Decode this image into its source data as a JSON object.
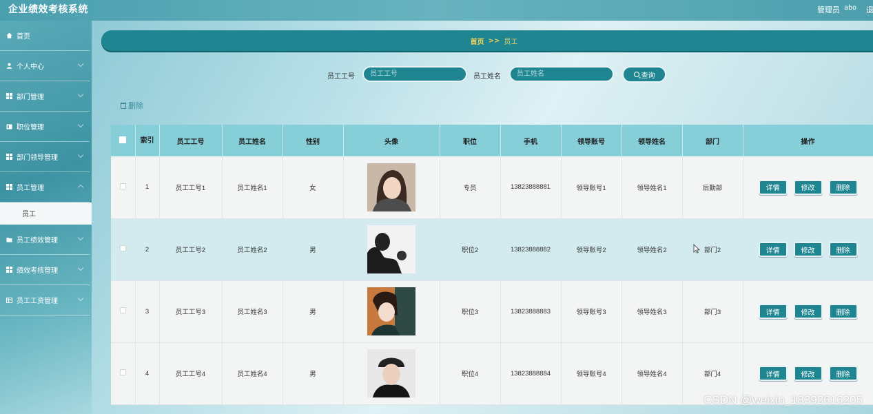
{
  "header": {
    "title": "企业绩效考核系统",
    "role": "管理员",
    "username": "abo",
    "logout": "退出"
  },
  "sidebar": {
    "items": [
      {
        "label": "首页",
        "icon": "home-icon"
      },
      {
        "label": "个人中心",
        "icon": "user-icon"
      },
      {
        "label": "部门管理",
        "icon": "grid-icon"
      },
      {
        "label": "职位管理",
        "icon": "card-icon"
      },
      {
        "label": "部门领导管理",
        "icon": "grid-icon"
      },
      {
        "label": "员工管理",
        "icon": "grid-icon"
      },
      {
        "label": "员工绩效管理",
        "icon": "folder-icon"
      },
      {
        "label": "绩效考核管理",
        "icon": "grid-icon"
      },
      {
        "label": "员工工资管理",
        "icon": "table-icon"
      }
    ],
    "sub_item": "员工"
  },
  "breadcrumb": {
    "home": "首页",
    "separator": ">>",
    "current": "员工"
  },
  "search": {
    "emp_no_label": "员工工号",
    "emp_no_placeholder": "员工工号",
    "emp_name_label": "员工姓名",
    "emp_name_placeholder": "员工姓名",
    "button": "查询"
  },
  "delete_label": "删除",
  "table": {
    "headers": [
      "",
      "索引",
      "员工工号",
      "员工姓名",
      "性别",
      "头像",
      "职位",
      "手机",
      "领导账号",
      "领导姓名",
      "部门",
      "操作"
    ],
    "rows": [
      {
        "index": "1",
        "emp_no": "员工工号1",
        "name": "员工姓名1",
        "gender": "女",
        "position": "专员",
        "phone": "13823888881",
        "leader_account": "领导账号1",
        "leader_name": "领导姓名1",
        "dept": "后勤部"
      },
      {
        "index": "2",
        "emp_no": "员工工号2",
        "name": "员工姓名2",
        "gender": "男",
        "position": "职位2",
        "phone": "13823888882",
        "leader_account": "领导账号2",
        "leader_name": "领导姓名2",
        "dept": "部门2"
      },
      {
        "index": "3",
        "emp_no": "员工工号3",
        "name": "员工姓名3",
        "gender": "男",
        "position": "职位3",
        "phone": "13823888883",
        "leader_account": "领导账号3",
        "leader_name": "领导姓名3",
        "dept": "部门3"
      },
      {
        "index": "4",
        "emp_no": "员工工号4",
        "name": "员工姓名4",
        "gender": "男",
        "position": "职位4",
        "phone": "13823888884",
        "leader_account": "领导账号4",
        "leader_name": "领导姓名4",
        "dept": "部门4"
      }
    ],
    "actions": {
      "detail": "详情",
      "edit": "修改",
      "delete": "删除"
    }
  },
  "watermark": "CSDN @weixin_18392616205",
  "colors": {
    "accent": "#1f8590",
    "header_row": "#86cfd8",
    "breadcrumb_text": "#f2d45c"
  }
}
